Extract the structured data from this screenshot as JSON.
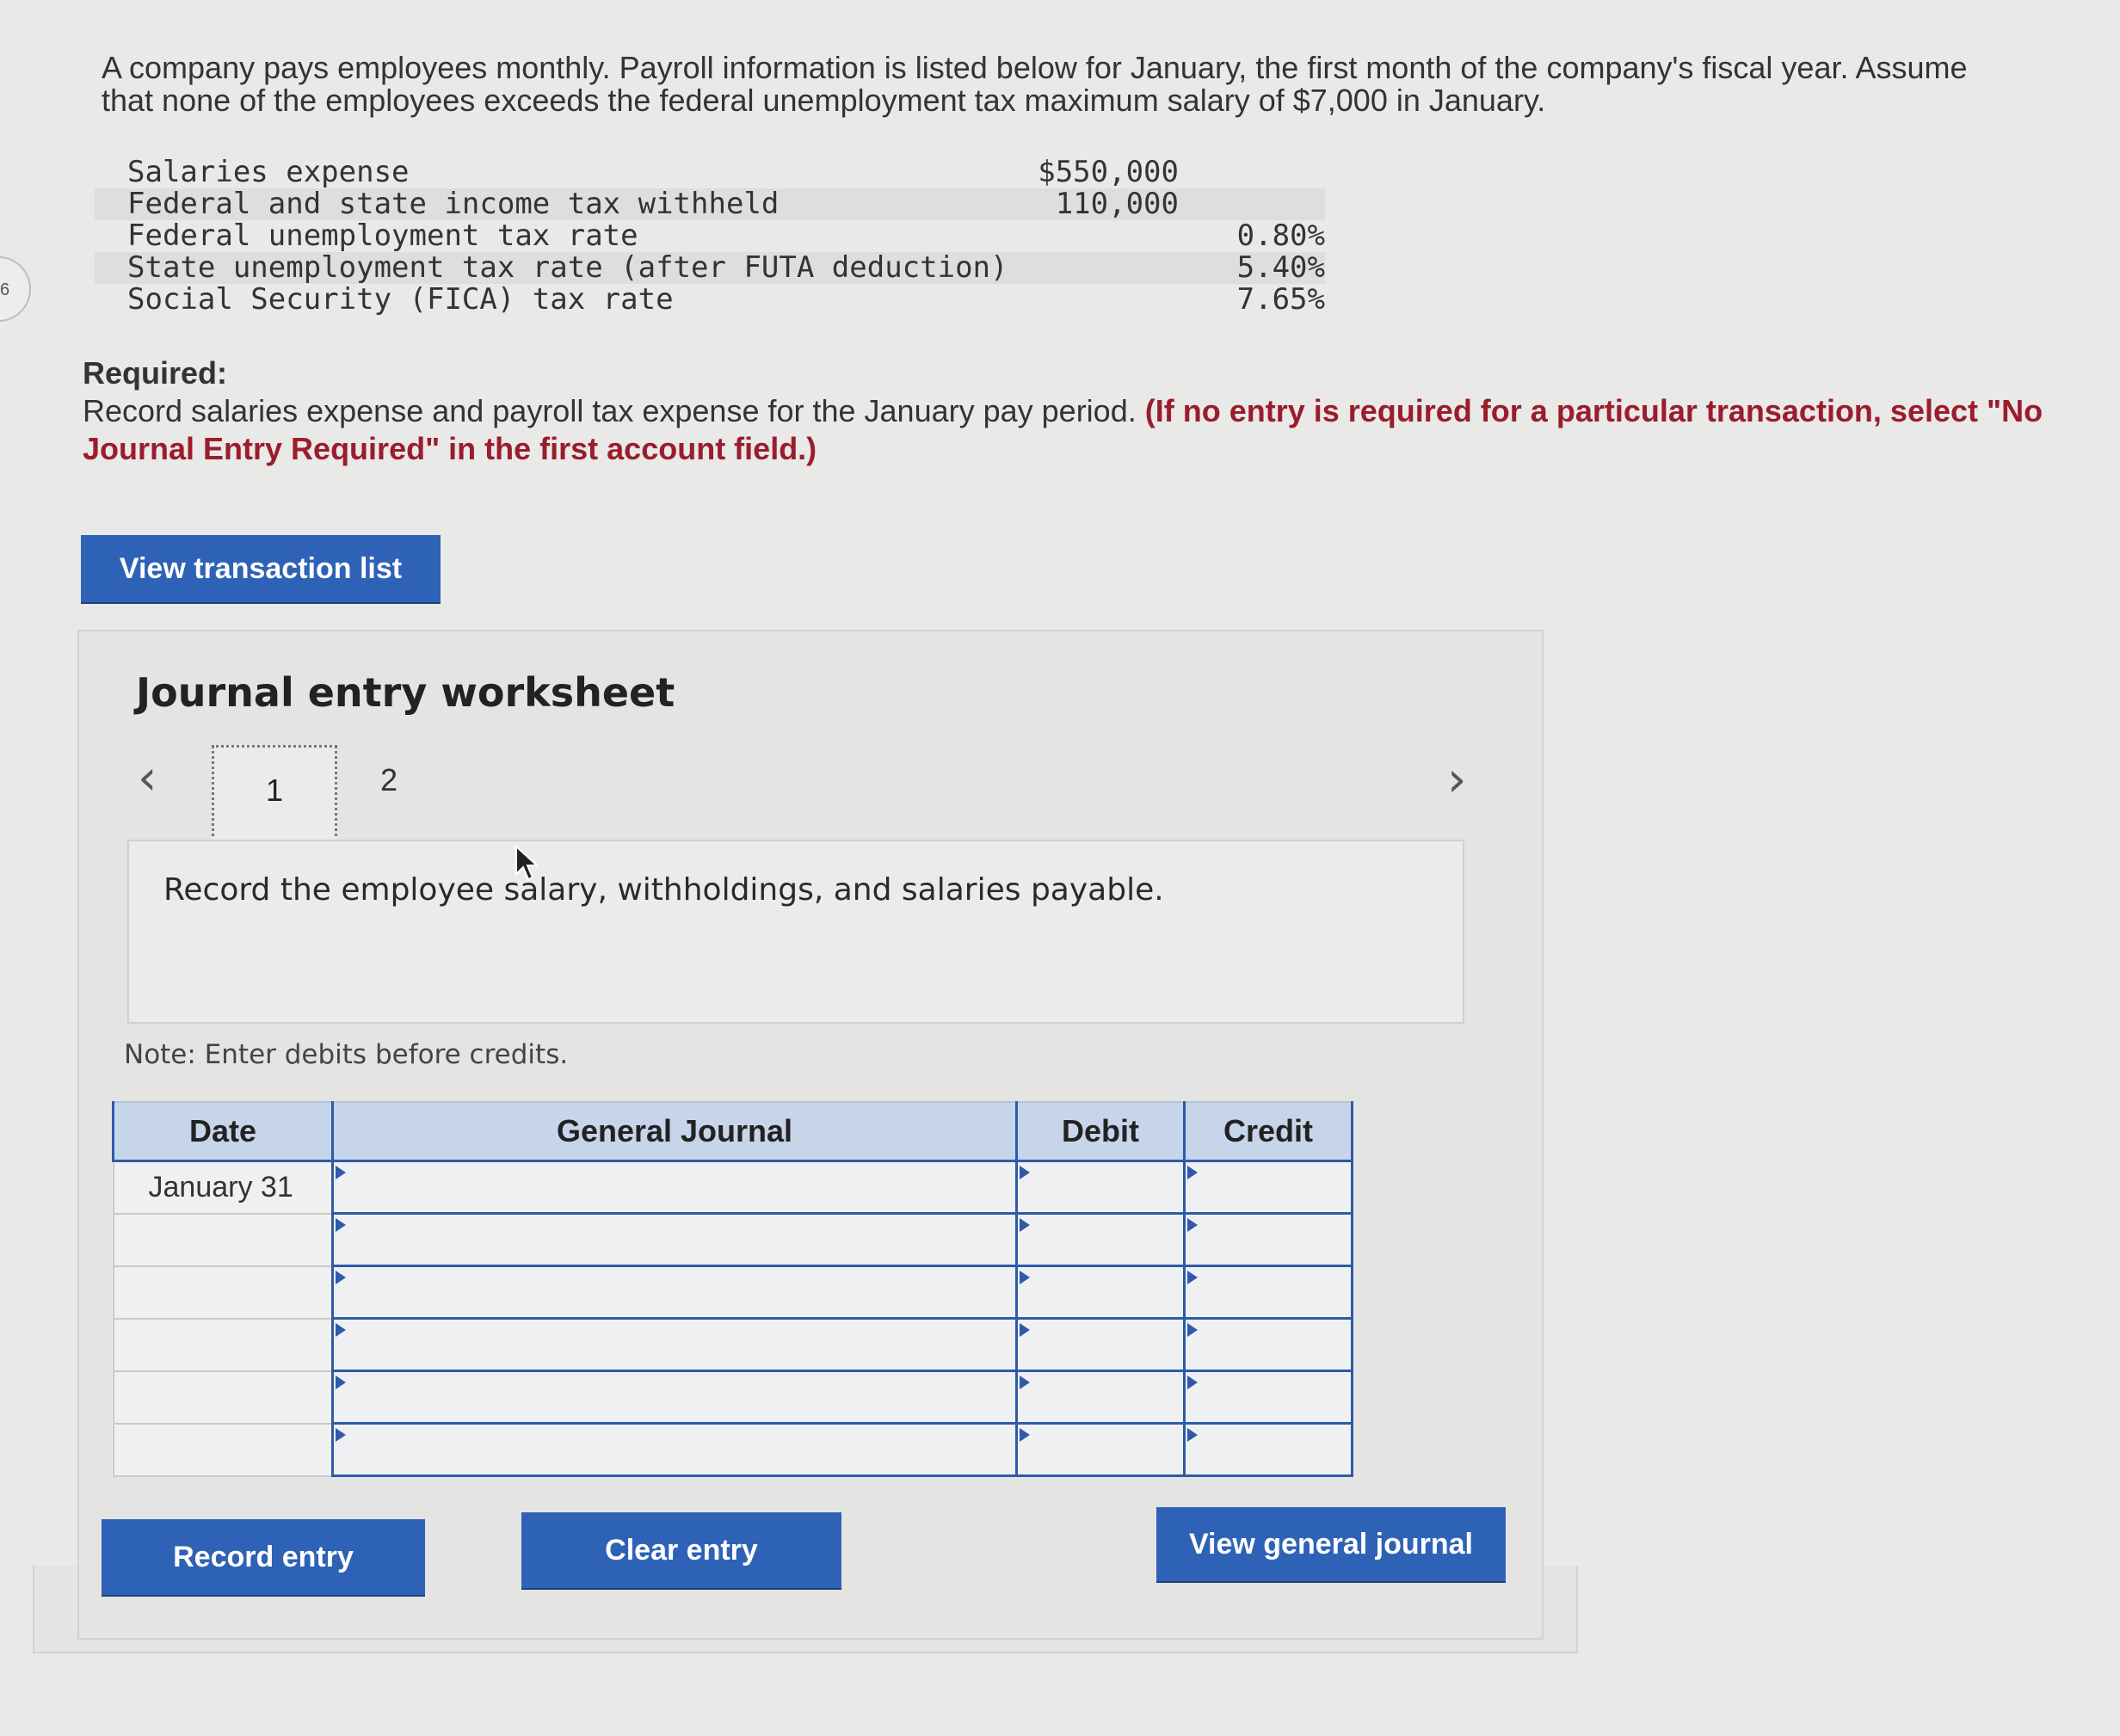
{
  "edge": {
    "question_number": "6"
  },
  "problem": {
    "intro": "A company pays employees monthly. Payroll information is listed below for January, the first month of the company's fiscal year. Assume that none of the employees exceeds the federal unemployment tax maximum salary of $7,000 in January.",
    "payroll_items": [
      {
        "label": "Salaries expense",
        "value": "$550,000"
      },
      {
        "label": "Federal and state income tax withheld",
        "value": "110,000"
      },
      {
        "label": "Federal unemployment tax rate",
        "value": "0.80%"
      },
      {
        "label": "State unemployment tax rate (after FUTA deduction)",
        "value": "5.40%"
      },
      {
        "label": "Social Security (FICA) tax rate",
        "value": "7.65%"
      }
    ],
    "required_heading": "Required:",
    "required_text": "Record salaries expense and payroll tax expense for the January pay period.",
    "required_note": "(If no entry is required for a particular transaction, select \"No Journal Entry Required\" in the first account field.)"
  },
  "buttons": {
    "view_transactions": "View transaction list",
    "record_entry": "Record entry",
    "clear_entry": "Clear entry",
    "view_journal": "View general journal"
  },
  "worksheet": {
    "title": "Journal entry worksheet",
    "pages": [
      "1",
      "2"
    ],
    "current_page": "1",
    "instruction": "Record the employee salary, withholdings, and salaries payable.",
    "note": "Note: Enter debits before credits.",
    "columns": [
      "Date",
      "General Journal",
      "Debit",
      "Credit"
    ],
    "rows": [
      {
        "date": "January 31",
        "account": "",
        "debit": "",
        "credit": ""
      },
      {
        "date": "",
        "account": "",
        "debit": "",
        "credit": ""
      },
      {
        "date": "",
        "account": "",
        "debit": "",
        "credit": ""
      },
      {
        "date": "",
        "account": "",
        "debit": "",
        "credit": ""
      },
      {
        "date": "",
        "account": "",
        "debit": "",
        "credit": ""
      },
      {
        "date": "",
        "account": "",
        "debit": "",
        "credit": ""
      }
    ]
  },
  "colors": {
    "button_blue": "#2e62b6",
    "header_blue": "#c7d5ea",
    "grid_blue": "#2f5aa8",
    "required_red": "#9b1c2c"
  }
}
